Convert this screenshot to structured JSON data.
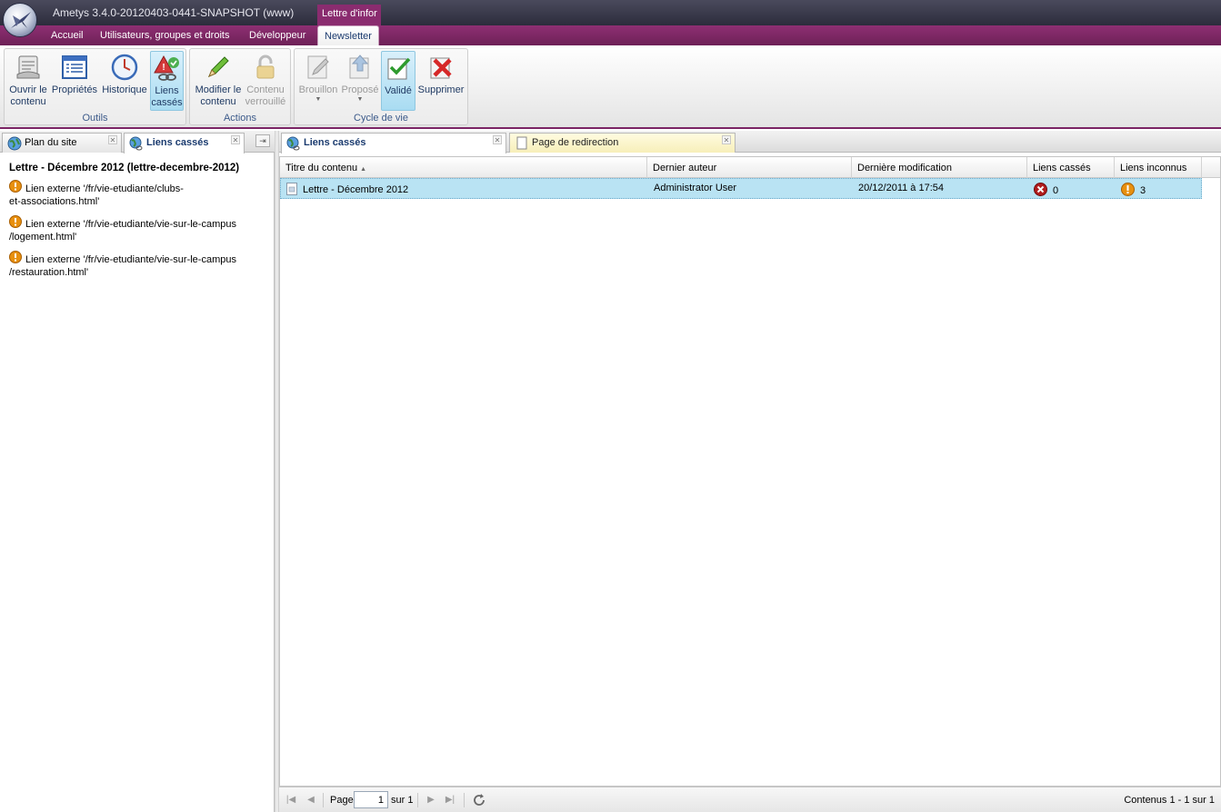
{
  "app": {
    "title": "Ametys 3.4.0-20120403-0441-SNAPSHOT (www)",
    "context_tab": "Lettre d'infor"
  },
  "ribbon_tabs": [
    {
      "label": "Accueil"
    },
    {
      "label": "Utilisateurs, groupes et droits"
    },
    {
      "label": "Développeur"
    },
    {
      "label": "Newsletter"
    }
  ],
  "ribbon": {
    "outils": {
      "label": "Outils",
      "open": "Ouvrir le\ncontenu",
      "props": "Propriétés",
      "history": "Historique",
      "broken": "Liens\ncassés"
    },
    "actions": {
      "label": "Actions",
      "edit": "Modifier le\ncontenu",
      "locked": "Contenu\nverrouillé"
    },
    "cycle": {
      "label": "Cycle de vie",
      "draft": "Brouillon",
      "proposed": "Proposé",
      "validated": "Validé",
      "delete": "Supprimer"
    }
  },
  "left_panel": {
    "tabs": [
      {
        "label": "Plan du site"
      },
      {
        "label": "Liens cassés"
      }
    ],
    "title": "Lettre - Décembre 2012 (lettre-decembre-2012)",
    "items": [
      {
        "line1": "Lien externe '/fr/vie-etudiante/clubs-",
        "line2": "et-associations.html'"
      },
      {
        "line1": "Lien externe '/fr/vie-etudiante/vie-sur-le-campus",
        "line2": "/logement.html'"
      },
      {
        "line1": "Lien externe '/fr/vie-etudiante/vie-sur-le-campus",
        "line2": "/restauration.html'"
      }
    ]
  },
  "main_panel": {
    "tabs": [
      {
        "label": "Liens cassés"
      },
      {
        "label": "Page de redirection"
      }
    ],
    "columns": [
      "Titre du contenu",
      "Dernier auteur",
      "Dernière modification",
      "Liens cassés",
      "Liens inconnus"
    ],
    "rows": [
      {
        "title": "Lettre - Décembre 2012",
        "author": "Administrator User",
        "modified": "20/12/2011 à 17:54",
        "broken": "0",
        "unknown": "3"
      }
    ],
    "pager": {
      "page_label": "Page",
      "page_value": "1",
      "of_label": "sur 1",
      "summary": "Contenus 1 - 1 sur 1"
    }
  },
  "colors": {
    "accent": "#8e2f73",
    "selection": "#b9e3f3",
    "warning": "#e8900f",
    "error": "#b01c1c"
  }
}
